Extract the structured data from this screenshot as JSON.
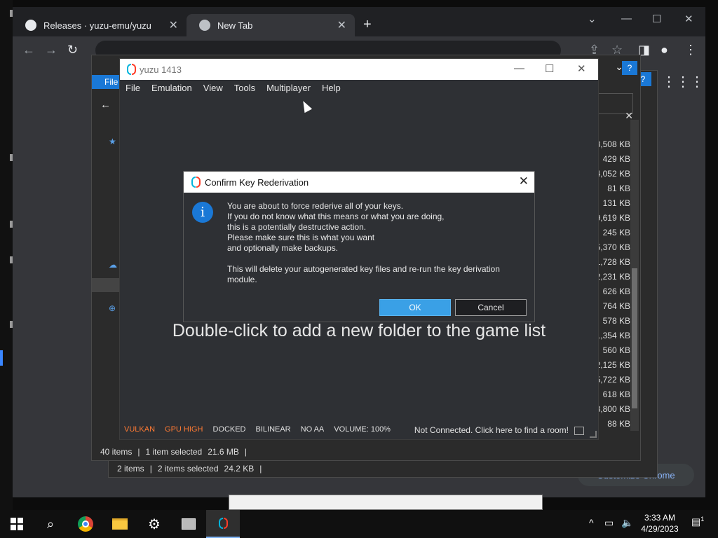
{
  "chrome": {
    "tabs": [
      {
        "label": "Releases · yuzu-emu/yuzu"
      },
      {
        "label": "New Tab"
      }
    ],
    "customize_label": "Customize Chrome"
  },
  "explorer_back": {
    "status": {
      "items": "2 items",
      "selected": "2 items selected",
      "size": "24.2 KB"
    }
  },
  "explorer_front": {
    "status": {
      "items": "40 items",
      "selected": "1 item selected",
      "size": "21.6 MB"
    },
    "file_sizes": [
      "3,508 KB",
      "429 KB",
      "4,052 KB",
      "81 KB",
      "131 KB",
      "9,619 KB",
      "245 KB",
      "5,370 KB",
      "1,728 KB",
      "2,231 KB",
      "626 KB",
      "764 KB",
      "578 KB",
      "1,354 KB",
      "560 KB",
      "2,125 KB",
      "5,722 KB",
      "618 KB",
      "8,800 KB",
      "88 KB"
    ],
    "menu_file": "File"
  },
  "yuzu": {
    "title": "yuzu 1413",
    "menu": [
      "File",
      "Emulation",
      "View",
      "Tools",
      "Multiplayer",
      "Help"
    ],
    "empty_message": "Double-click to add a new folder to the game list",
    "status": {
      "vulkan": "VULKAN",
      "gpu": "GPU HIGH",
      "docked": "DOCKED",
      "filter": "BILINEAR",
      "aa": "NO AA",
      "volume": "VOLUME: 100%",
      "room": "Not Connected. Click here to find a room!"
    }
  },
  "dialog": {
    "title": "Confirm Key Rederivation",
    "text1": "You are about to force rederive all of your keys.\nIf you do not know what this means or what you are doing,\nthis is a potentially destructive action.\nPlease make sure this is what you want\nand optionally make backups.",
    "text2": "This will delete your autogenerated key files and re-run the key derivation\nmodule.",
    "ok_label": "OK",
    "cancel_label": "Cancel"
  },
  "taskbar": {
    "time": "3:33 AM",
    "date": "4/29/2023",
    "notification_count": "1"
  },
  "icons": [
    "windows-start-icon",
    "search-icon",
    "chrome-icon",
    "file-explorer-icon",
    "settings-icon",
    "app-icon",
    "yuzu-icon",
    "info-icon",
    "close-icon"
  ]
}
